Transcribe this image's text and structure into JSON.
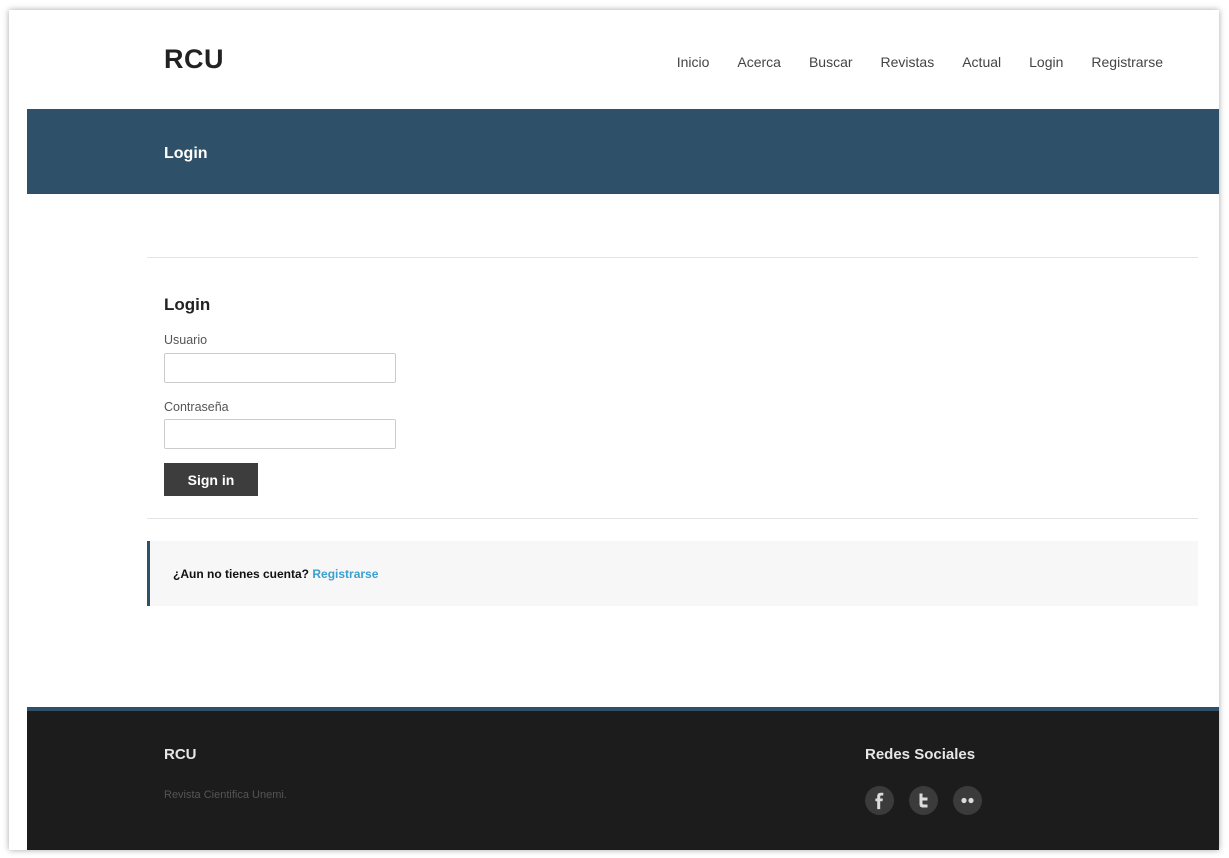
{
  "header": {
    "brand": "RCU",
    "nav": [
      "Inicio",
      "Acerca",
      "Buscar",
      "Revistas",
      "Actual",
      "Login",
      "Registrarse"
    ]
  },
  "hero": {
    "title": "Login"
  },
  "form": {
    "title": "Login",
    "username_label": "Usuario",
    "username_value": "",
    "password_label": "Contraseña",
    "password_value": "",
    "submit_label": "Sign in"
  },
  "callout": {
    "text": "¿Aun no tienes cuenta?",
    "link_label": "Registrarse"
  },
  "footer": {
    "brand": "RCU",
    "tagline": "Revista Cientifica Unemi.",
    "social_title": "Redes Sociales",
    "social_icons": [
      "facebook-icon",
      "twitter-icon",
      "flickr-icon"
    ]
  },
  "colors": {
    "hero_bg": "#2e5068",
    "footer_bg": "#1c1c1c",
    "button_bg": "#3d3d3d",
    "link": "#3aa0d0"
  }
}
